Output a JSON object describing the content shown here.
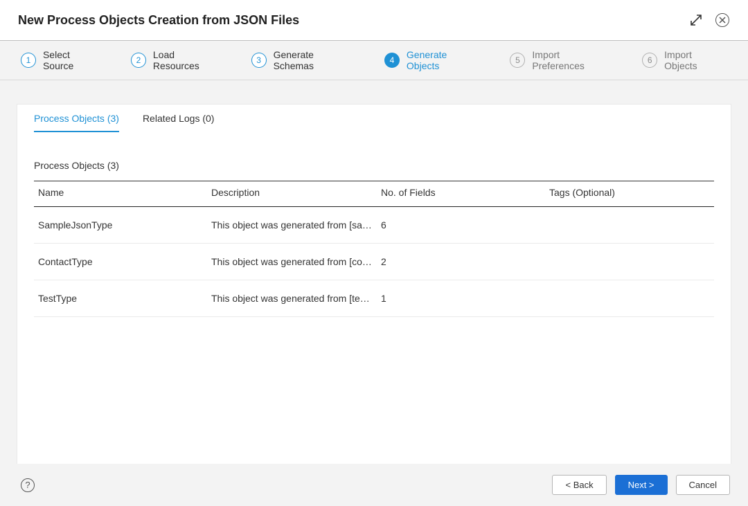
{
  "header": {
    "title": "New Process Objects Creation from JSON Files"
  },
  "stepper": {
    "steps": [
      {
        "num": "1",
        "label": "Select Source",
        "state": "past"
      },
      {
        "num": "2",
        "label": "Load Resources",
        "state": "past"
      },
      {
        "num": "3",
        "label": "Generate Schemas",
        "state": "past"
      },
      {
        "num": "4",
        "label": "Generate Objects",
        "state": "active"
      },
      {
        "num": "5",
        "label": "Import Preferences",
        "state": "future"
      },
      {
        "num": "6",
        "label": "Import Objects",
        "state": "future"
      }
    ]
  },
  "tabs": {
    "tab0": "Process Objects (3)",
    "tab1": "Related Logs (0)"
  },
  "section": {
    "title": "Process Objects (3)"
  },
  "table": {
    "headers": {
      "name": "Name",
      "description": "Description",
      "fields": "No. of Fields",
      "tags": "Tags (Optional)"
    },
    "rows": [
      {
        "name": "SampleJsonType",
        "description": "This object was generated from [sample...",
        "fields": "6",
        "tags": ""
      },
      {
        "name": "ContactType",
        "description": "This object was generated from [contact...",
        "fields": "2",
        "tags": ""
      },
      {
        "name": "TestType",
        "description": "This object was generated from [testTyp...",
        "fields": "1",
        "tags": ""
      }
    ]
  },
  "footer": {
    "help": "?",
    "back": "< Back",
    "next": "Next >",
    "cancel": "Cancel"
  }
}
